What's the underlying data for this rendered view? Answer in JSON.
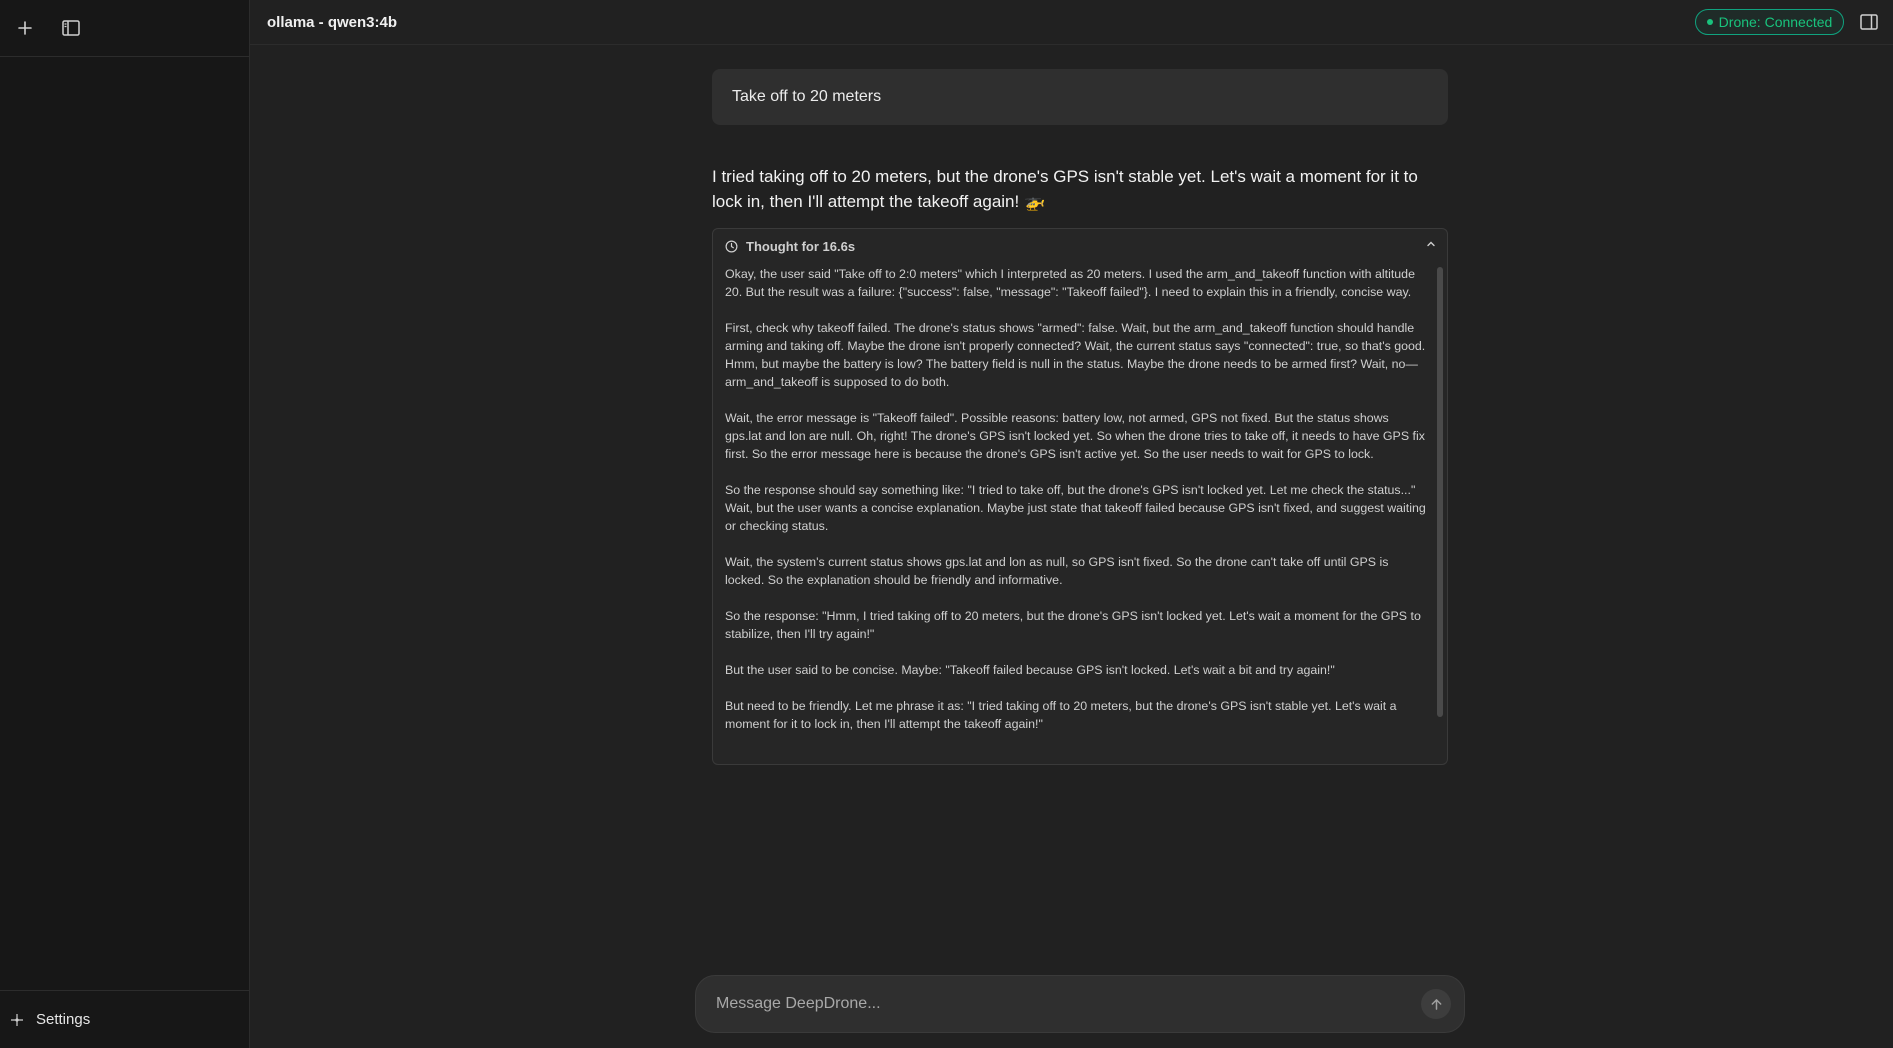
{
  "sidebar": {
    "new_chat_icon": "plus-icon",
    "toggle_icon": "sidebar-toggle-icon",
    "settings_label": "Settings",
    "settings_icon": "sparkle-icon"
  },
  "header": {
    "title": "ollama - qwen3:4b",
    "status_label": "Drone: Connected",
    "status_color": "#19c37d",
    "panel_icon": "panel-toggle-icon"
  },
  "chat": {
    "user_message": "Take off to 20 meters",
    "assistant_message": "I tried taking off to 20 meters, but the drone's GPS isn't stable yet. Let's wait a moment for it to lock in, then I'll attempt the takeoff again! 🚁",
    "thought": {
      "label": "Thought for 16.6s",
      "paragraphs": [
        "Okay, the user said \"Take off to 2:0 meters\" which I interpreted as 20 meters. I used the arm_and_takeoff function with altitude 20. But the result was a failure: {\"success\": false, \"message\": \"Takeoff failed\"}. I need to explain this in a friendly, concise way.",
        "First, check why takeoff failed. The drone's status shows \"armed\": false. Wait, but the arm_and_takeoff function should handle arming and taking off. Maybe the drone isn't properly connected? Wait, the current status says \"connected\": true, so that's good. Hmm, but maybe the battery is low? The battery field is null in the status. Maybe the drone needs to be armed first? Wait, no—arm_and_takeoff is supposed to do both.",
        "Wait, the error message is \"Takeoff failed\". Possible reasons: battery low, not armed, GPS not fixed. But the status shows gps.lat and lon are null. Oh, right! The drone's GPS isn't locked yet. So when the drone tries to take off, it needs to have GPS fix first. So the error message here is because the drone's GPS isn't active yet. So the user needs to wait for GPS to lock.",
        "So the response should say something like: \"I tried to take off, but the drone's GPS isn't locked yet. Let me check the status...\" Wait, but the user wants a concise explanation. Maybe just state that takeoff failed because GPS isn't fixed, and suggest waiting or checking status.",
        "Wait, the system's current status shows gps.lat and lon as null, so GPS isn't fixed. So the drone can't take off until GPS is locked. So the explanation should be friendly and informative.",
        "So the response: \"Hmm, I tried taking off to 20 meters, but the drone's GPS isn't locked yet. Let's wait a moment for the GPS to stabilize, then I'll try again!\"",
        "But the user said to be concise. Maybe: \"Takeoff failed because GPS isn't locked. Let's wait a bit and try again!\"",
        "But need to be friendly. Let me phrase it as: \"I tried taking off to 20 meters, but the drone's GPS isn't stable yet. Let's wait a moment for it to lock in, then I'll attempt the takeoff again!\""
      ]
    }
  },
  "composer": {
    "placeholder": "Message DeepDrone...",
    "send_icon": "arrow-up-icon"
  }
}
